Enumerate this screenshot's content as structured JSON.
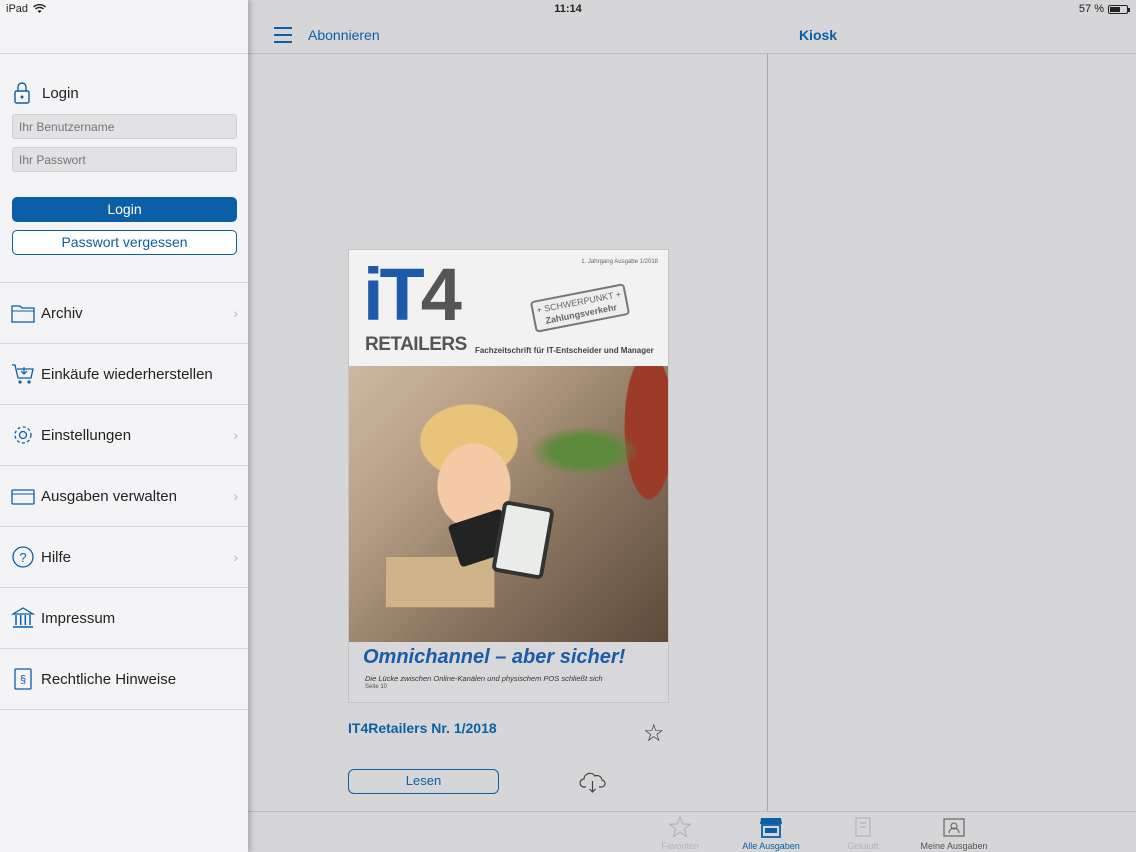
{
  "status_bar": {
    "device": "iPad",
    "time": "11:14",
    "battery": "57 %",
    "battery_level": 0.57
  },
  "sidebar": {
    "login_heading": "Login",
    "username_placeholder": "Ihr Benutzername",
    "password_placeholder": "Ihr Passwort",
    "login_button": "Login",
    "forgot_button": "Passwort vergessen",
    "menu": [
      {
        "label": "Archiv",
        "icon": "folder-icon",
        "chevron": true
      },
      {
        "label": "Einkäufe wiederherstellen",
        "icon": "cart-icon",
        "chevron": false
      },
      {
        "label": "Einstellungen",
        "icon": "gear-icon",
        "chevron": true
      },
      {
        "label": "Ausgaben verwalten",
        "icon": "tray-icon",
        "chevron": true
      },
      {
        "label": "Hilfe",
        "icon": "help-icon",
        "chevron": true
      },
      {
        "label": "Impressum",
        "icon": "bank-icon",
        "chevron": false
      },
      {
        "label": "Rechtliche Hinweise",
        "icon": "legal-icon",
        "chevron": false
      }
    ]
  },
  "navbar": {
    "subscribe": "Abonnieren",
    "title": "Kiosk"
  },
  "issue": {
    "cover": {
      "logo_it": "iT",
      "logo_4": "4",
      "logo_retailers": "RETAILERS",
      "meta": "1. Jahrgang    Ausgabe 1/2018",
      "stamp_line1": "+ SCHWERPUNKT +",
      "stamp_line2": "Zahlungsverkehr",
      "tagline": "Fachzeitschrift für IT-Entscheider und Manager",
      "headline": "Omnichannel – aber sicher!",
      "subline": "Die Lücke zwischen Online-Kanälen und physischem POS schließt sich",
      "page_ref": "Seite 10"
    },
    "title": "IT4Retailers Nr. 1/2018",
    "read_button": "Lesen"
  },
  "tabbar": [
    {
      "label": "Favoriten",
      "icon": "star-icon",
      "state": "dim"
    },
    {
      "label": "Alle Ausgaben",
      "icon": "kiosk-icon",
      "state": "active"
    },
    {
      "label": "Gekauft",
      "icon": "purchased-icon",
      "state": "dim"
    },
    {
      "label": "Meine Ausgaben",
      "icon": "my-issues-icon",
      "state": "normal"
    }
  ],
  "colors": {
    "accent": "#0b5fa7",
    "brand_blue": "#1d5aa8"
  }
}
